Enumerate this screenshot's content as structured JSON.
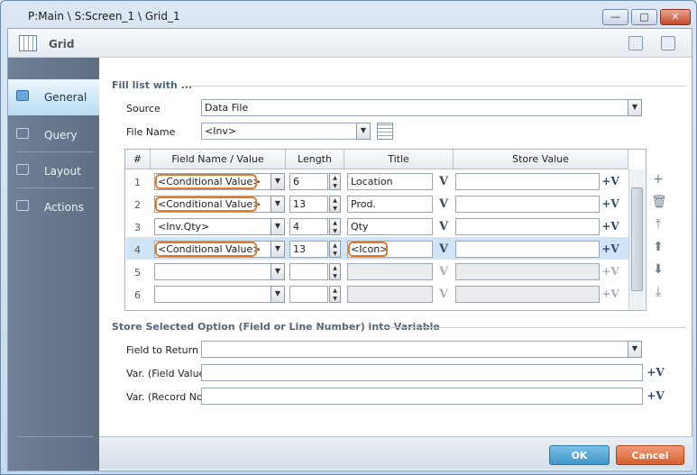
{
  "window": {
    "title": "P:Main \\ S:Screen_1 \\ Grid_1",
    "min_glyph": "—",
    "max_glyph": "□",
    "close_glyph": "✕"
  },
  "header": {
    "title": "Grid"
  },
  "nav": {
    "items": [
      {
        "label": "General",
        "icon": "general-icon",
        "active": true
      },
      {
        "label": "Query",
        "icon": "query-icon",
        "active": false
      },
      {
        "label": "Layout",
        "icon": "layout-icon",
        "active": false
      },
      {
        "label": "Actions",
        "icon": "actions-icon",
        "active": false
      }
    ]
  },
  "fill_section": {
    "title": "Fill list with ...",
    "source_label": "Source",
    "source_value": "Data File",
    "file_name_label": "File Name",
    "file_name_value": "<Inv>"
  },
  "grid": {
    "headers": [
      "#",
      "Field Name / Value",
      "Length",
      "Title",
      "Store Value"
    ],
    "rows": [
      {
        "num": "1",
        "field": "<Conditional Value>",
        "length": "6",
        "title": "Location",
        "store": ""
      },
      {
        "num": "2",
        "field": "<Conditional Value>",
        "length": "13",
        "title": "Prod.",
        "store": ""
      },
      {
        "num": "3",
        "field": "<Inv.Qty>",
        "length": "4",
        "title": "Qty",
        "store": ""
      },
      {
        "num": "4",
        "field": "<Conditional Value>",
        "length": "13",
        "title": "<Icon>",
        "store": ""
      },
      {
        "num": "5",
        "field": "",
        "length": "",
        "title": "",
        "store": ""
      },
      {
        "num": "6",
        "field": "",
        "length": "",
        "title": "",
        "store": ""
      }
    ],
    "v_glyph": "V",
    "pv_glyph": "+V"
  },
  "store_section": {
    "title": "Store Selected Option (Field or Line Number) into Variable",
    "field_to_return_label": "Field to Return",
    "field_to_return_value": "",
    "var_field_label": "Var. (Field Value)",
    "var_field_value": "",
    "var_record_label": "Var. (Record No)",
    "var_record_value": ""
  },
  "side_tools": {
    "add": "+",
    "delete": "🗑",
    "top": "⤒",
    "up": "⬆",
    "down": "⬇",
    "bottom": "⤓"
  },
  "footer": {
    "ok_label": "OK",
    "cancel_label": "Cancel"
  },
  "colors": {
    "highlight": "#e07a2a",
    "ok": "#3f95c8",
    "cancel": "#d6602f",
    "selected_row": "#cfe4f7"
  }
}
